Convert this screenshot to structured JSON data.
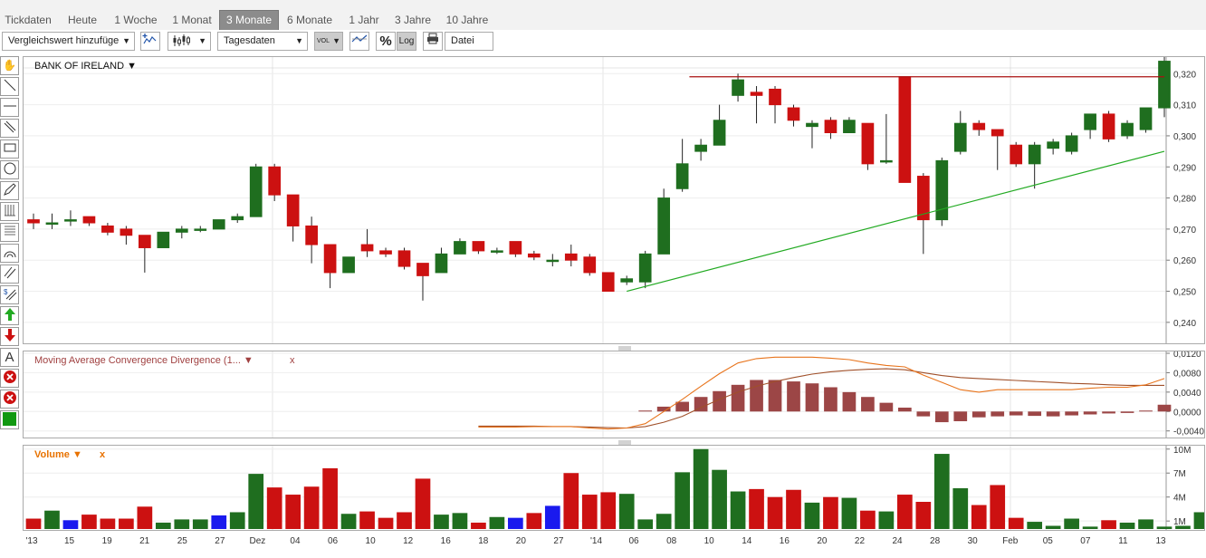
{
  "tabs": [
    {
      "label": "Tickdaten",
      "active": false
    },
    {
      "label": "Heute",
      "active": false
    },
    {
      "label": "1 Woche",
      "active": false
    },
    {
      "label": "1 Monat",
      "active": false
    },
    {
      "label": "3 Monate",
      "active": true
    },
    {
      "label": "6 Monate",
      "active": false
    },
    {
      "label": "1 Jahr",
      "active": false
    },
    {
      "label": "3 Jahre",
      "active": false
    },
    {
      "label": "10 Jahre",
      "active": false
    }
  ],
  "toolbar": {
    "compare_label": "Vergleichswert hinzufüge",
    "period_label": "Tagesdaten",
    "vol_label": "VOL",
    "percent_label": "%",
    "log_label": "Log",
    "file_label": "Datei"
  },
  "left_tools": [
    "hand-icon",
    "line-icon",
    "horizontal-line-icon",
    "parallel-lines-icon",
    "rectangle-icon",
    "circle-icon",
    "pen-icon",
    "fibonacci-icon",
    "fibonacci-fan-icon",
    "arc-icon",
    "channel-icon",
    "dollar-line-icon",
    "buy-arrow-icon",
    "sell-arrow-icon",
    "text-icon",
    "delete-icon",
    "delete-all-icon",
    "color-icon"
  ],
  "colors": {
    "up": "#1f6e1f",
    "down": "#cc1111",
    "blue": "#1a1aee",
    "resistance": "#aa1010",
    "trend": "#22aa22",
    "macd": "#e8741c",
    "signal": "#a0502a",
    "hist": "#9c4646",
    "volume_title": "#e87200",
    "macd_title": "#a04040"
  },
  "main_chart": {
    "title": "BANK OF IRELAND ▼",
    "y_labels": [
      "0,320",
      "0,310",
      "0,300",
      "0,290",
      "0,280",
      "0,270",
      "0,260",
      "0,250",
      "0,240"
    ]
  },
  "macd_panel": {
    "title": "Moving Average Convergence Divergence (1... ▼",
    "close": "x",
    "y_labels": [
      "0,0120",
      "0,0080",
      "0,0040",
      "0,0000",
      "-0,0040"
    ]
  },
  "volume_panel": {
    "title": "Volume ▼",
    "close": "x",
    "y_labels": [
      "10M",
      "7M",
      "4M",
      "1M"
    ]
  },
  "x_labels": [
    "'13",
    "15",
    "19",
    "21",
    "25",
    "27",
    "Dez",
    "04",
    "06",
    "10",
    "12",
    "16",
    "18",
    "20",
    "27",
    "'14",
    "06",
    "08",
    "10",
    "14",
    "16",
    "20",
    "22",
    "24",
    "28",
    "30",
    "Feb",
    "05",
    "07",
    "11",
    "13"
  ],
  "chart_data": {
    "type": "candlestick",
    "title": "BANK OF IRELAND",
    "ylim": [
      0.235,
      0.323
    ],
    "grid": true,
    "candles": [
      [
        0.273,
        0.272,
        0.275,
        0.27
      ],
      [
        0.272,
        0.272,
        0.275,
        0.27
      ],
      [
        0.273,
        0.273,
        0.276,
        0.271
      ],
      [
        0.274,
        0.272,
        0.274,
        0.271
      ],
      [
        0.271,
        0.269,
        0.272,
        0.268
      ],
      [
        0.27,
        0.268,
        0.271,
        0.265
      ],
      [
        0.268,
        0.264,
        0.268,
        0.256
      ],
      [
        0.264,
        0.269,
        0.269,
        0.264
      ],
      [
        0.269,
        0.27,
        0.271,
        0.267
      ],
      [
        0.27,
        0.27,
        0.271,
        0.269
      ],
      [
        0.27,
        0.273,
        0.273,
        0.27
      ],
      [
        0.273,
        0.274,
        0.275,
        0.272
      ],
      [
        0.274,
        0.29,
        0.291,
        0.274
      ],
      [
        0.29,
        0.281,
        0.291,
        0.279
      ],
      [
        0.281,
        0.271,
        0.281,
        0.266
      ],
      [
        0.271,
        0.265,
        0.274,
        0.259
      ],
      [
        0.265,
        0.256,
        0.265,
        0.251
      ],
      [
        0.256,
        0.261,
        0.261,
        0.256
      ],
      [
        0.265,
        0.263,
        0.27,
        0.261
      ],
      [
        0.263,
        0.262,
        0.264,
        0.261
      ],
      [
        0.263,
        0.258,
        0.264,
        0.257
      ],
      [
        0.259,
        0.255,
        0.259,
        0.247
      ],
      [
        0.256,
        0.262,
        0.264,
        0.256
      ],
      [
        0.262,
        0.266,
        0.267,
        0.262
      ],
      [
        0.266,
        0.263,
        0.266,
        0.262
      ],
      [
        0.263,
        0.263,
        0.264,
        0.262
      ],
      [
        0.266,
        0.262,
        0.266,
        0.261
      ],
      [
        0.262,
        0.261,
        0.263,
        0.26
      ],
      [
        0.26,
        0.26,
        0.262,
        0.258
      ],
      [
        0.262,
        0.26,
        0.265,
        0.258
      ],
      [
        0.261,
        0.256,
        0.262,
        0.255
      ],
      [
        0.256,
        0.25,
        0.256,
        0.25
      ],
      [
        0.253,
        0.254,
        0.255,
        0.252
      ],
      [
        0.253,
        0.262,
        0.263,
        0.251
      ],
      [
        0.262,
        0.28,
        0.283,
        0.262
      ],
      [
        0.283,
        0.291,
        0.299,
        0.282
      ],
      [
        0.295,
        0.297,
        0.299,
        0.292
      ],
      [
        0.297,
        0.305,
        0.31,
        0.297
      ],
      [
        0.313,
        0.318,
        0.32,
        0.311
      ],
      [
        0.314,
        0.313,
        0.316,
        0.304
      ],
      [
        0.315,
        0.31,
        0.316,
        0.304
      ],
      [
        0.309,
        0.305,
        0.31,
        0.303
      ],
      [
        0.303,
        0.304,
        0.305,
        0.296
      ],
      [
        0.305,
        0.301,
        0.306,
        0.299
      ],
      [
        0.301,
        0.305,
        0.306,
        0.301
      ],
      [
        0.304,
        0.291,
        0.304,
        0.289
      ],
      [
        0.292,
        0.292,
        0.307,
        0.291
      ],
      [
        0.319,
        0.285,
        0.319,
        0.285
      ],
      [
        0.287,
        0.273,
        0.288,
        0.262
      ],
      [
        0.273,
        0.292,
        0.293,
        0.271
      ],
      [
        0.295,
        0.304,
        0.308,
        0.294
      ],
      [
        0.304,
        0.302,
        0.305,
        0.3
      ],
      [
        0.302,
        0.3,
        0.302,
        0.289
      ],
      [
        0.297,
        0.291,
        0.298,
        0.29
      ],
      [
        0.291,
        0.297,
        0.298,
        0.283
      ],
      [
        0.296,
        0.298,
        0.299,
        0.294
      ],
      [
        0.295,
        0.3,
        0.301,
        0.294
      ],
      [
        0.302,
        0.307,
        0.307,
        0.299
      ],
      [
        0.307,
        0.299,
        0.308,
        0.298
      ],
      [
        0.3,
        0.304,
        0.305,
        0.299
      ],
      [
        0.302,
        0.309,
        0.309,
        0.301
      ],
      [
        0.309,
        0.324,
        0.326,
        0.306
      ]
    ],
    "highlight_blue": [
      2,
      10,
      26,
      28
    ],
    "resistance_line": {
      "from_index": 36,
      "to_index": 61,
      "value": 0.319
    },
    "trend_line": {
      "from": [
        32,
        0.25
      ],
      "to": [
        61,
        0.295
      ]
    },
    "macd": {
      "ylim": [
        -0.0048,
        0.012
      ],
      "macd": [
        null,
        null,
        null,
        null,
        null,
        null,
        null,
        null,
        null,
        null,
        null,
        null,
        null,
        null,
        null,
        null,
        null,
        null,
        null,
        null,
        null,
        null,
        null,
        null,
        -0.0032,
        -0.0032,
        -0.0032,
        -0.0031,
        -0.0031,
        -0.0031,
        -0.0034,
        -0.0036,
        -0.0034,
        -0.0025,
        0.0,
        0.0025,
        0.0052,
        0.0078,
        0.01,
        0.0109,
        0.0112,
        0.0112,
        0.0112,
        0.011,
        0.0107,
        0.01,
        0.0095,
        0.0092,
        0.0075,
        0.006,
        0.0045,
        0.004,
        0.0045,
        0.0045,
        0.0045,
        0.0045,
        0.0045,
        0.0048,
        0.005,
        0.005,
        0.0055,
        0.0068
      ],
      "signal": [
        null,
        null,
        null,
        null,
        null,
        null,
        null,
        null,
        null,
        null,
        null,
        null,
        null,
        null,
        null,
        null,
        null,
        null,
        null,
        null,
        null,
        null,
        null,
        null,
        -0.003,
        -0.003,
        -0.003,
        -0.003,
        -0.0031,
        -0.0031,
        -0.0032,
        -0.0033,
        -0.0034,
        -0.0031,
        -0.0022,
        -0.001,
        0.0008,
        0.0025,
        0.004,
        0.0052,
        0.0062,
        0.007,
        0.0077,
        0.0082,
        0.0085,
        0.0087,
        0.0088,
        0.0086,
        0.008,
        0.0074,
        0.007,
        0.0068,
        0.0066,
        0.0064,
        0.0062,
        0.006,
        0.0058,
        0.0057,
        0.0055,
        0.0054,
        0.0054,
        0.0054
      ],
      "hist": [
        null,
        null,
        null,
        null,
        null,
        null,
        null,
        null,
        null,
        null,
        null,
        null,
        null,
        null,
        null,
        null,
        null,
        null,
        null,
        null,
        null,
        null,
        null,
        null,
        null,
        null,
        null,
        null,
        null,
        null,
        null,
        null,
        null,
        0.0002,
        0.001,
        0.002,
        0.003,
        0.0042,
        0.0055,
        0.0065,
        0.0065,
        0.0062,
        0.0058,
        0.005,
        0.004,
        0.003,
        0.0018,
        0.0008,
        -0.001,
        -0.0022,
        -0.002,
        -0.0012,
        -0.001,
        -0.0008,
        -0.0009,
        -0.001,
        -0.0008,
        -0.0006,
        -0.0004,
        -0.0003,
        0.0002,
        0.0014
      ]
    },
    "volume": {
      "ylim": [
        0,
        10.2
      ],
      "unit": "M",
      "values": [
        1.3,
        2.3,
        1.1,
        1.8,
        1.3,
        1.3,
        2.8,
        0.8,
        1.2,
        1.2,
        1.7,
        2.1,
        6.9,
        5.2,
        4.3,
        5.3,
        7.6,
        1.9,
        2.2,
        1.4,
        2.1,
        6.3,
        1.8,
        2.0,
        0.8,
        1.5,
        1.4,
        2.0,
        2.9,
        7.0,
        4.3,
        4.6,
        4.4,
        1.2,
        1.9,
        7.1,
        10.0,
        7.4,
        4.7,
        5.0,
        4.0,
        4.9,
        3.3,
        4.0,
        3.9,
        2.3,
        2.2,
        4.3,
        3.4,
        9.4,
        5.1,
        3.0,
        5.5,
        1.4,
        0.9,
        0.4,
        1.3,
        0.3,
        1.1,
        0.8,
        1.2,
        0.3,
        0.4,
        2.1
      ]
    }
  }
}
